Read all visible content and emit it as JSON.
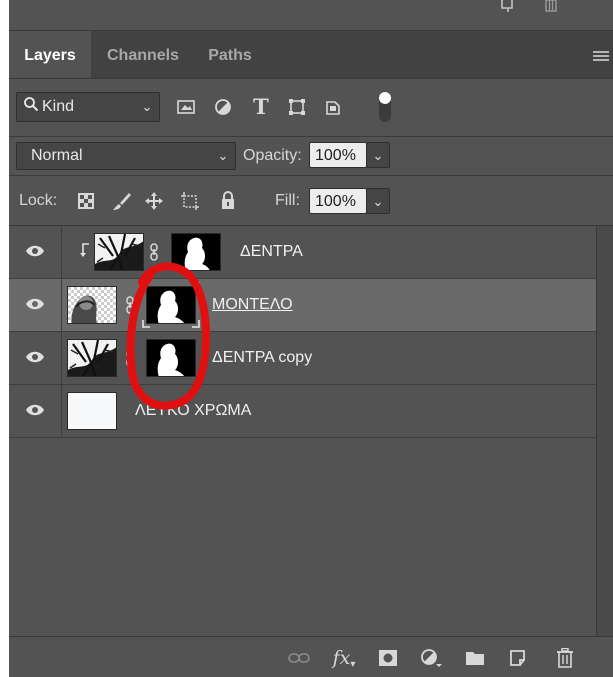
{
  "tabs": [
    {
      "label": "Layers",
      "active": true
    },
    {
      "label": "Channels",
      "active": false
    },
    {
      "label": "Paths",
      "active": false
    }
  ],
  "filter": {
    "kind_label": "Kind"
  },
  "blend": {
    "mode": "Normal",
    "opacity_label": "Opacity:",
    "opacity_value": "100%"
  },
  "lock": {
    "label": "Lock:",
    "fill_label": "Fill:",
    "fill_value": "100%"
  },
  "layers": [
    {
      "name": "ΔΕΝΤΡΑ",
      "clipped": true,
      "linked": true,
      "selected": false
    },
    {
      "name": "ΜΟΝΤΕΛΟ",
      "clipped": false,
      "linked": true,
      "selected": true
    },
    {
      "name": "ΔΕΝΤΡΑ copy",
      "clipped": false,
      "linked": true,
      "selected": false
    },
    {
      "name": "ΛΕΥΚΟ ΧΡΩΜΑ",
      "clipped": false,
      "linked": false,
      "selected": false
    }
  ],
  "bottom_icons": [
    "link-icon",
    "fx-icon",
    "mask-icon",
    "adjustment-icon",
    "folder-icon",
    "new-layer-icon",
    "trash-icon"
  ],
  "colors": {
    "panel": "#535353",
    "tabbar": "#424242",
    "selected_row": "#6a6a6a",
    "annotation": "#e01010"
  }
}
